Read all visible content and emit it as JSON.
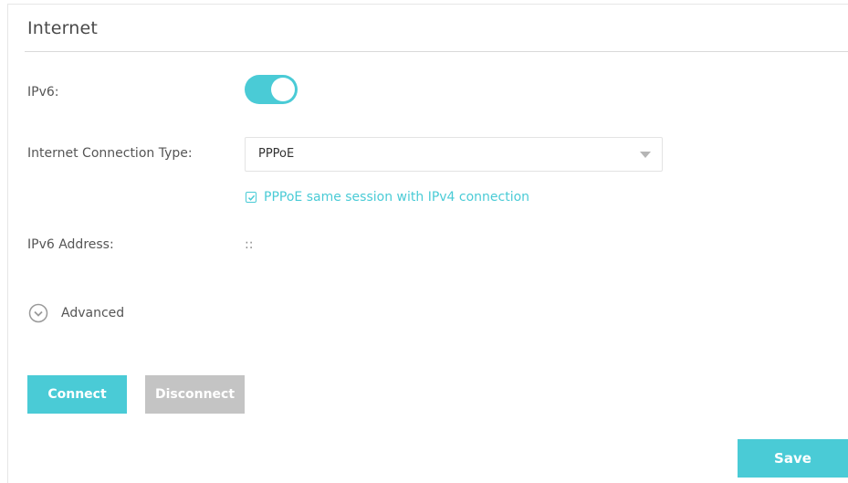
{
  "section": {
    "title": "Internet"
  },
  "form": {
    "ipv6_label": "IPv6:",
    "ipv6_enabled": true,
    "connection_type_label": "Internet Connection Type:",
    "connection_type_value": "PPPoE",
    "same_session_label": "PPPoE same session with IPv4 connection",
    "same_session_checked": true,
    "ipv6_address_label": "IPv6 Address:",
    "ipv6_address_value": "::"
  },
  "advanced": {
    "label": "Advanced",
    "icon": "chevron-down-circle-icon"
  },
  "buttons": {
    "connect_label": "Connect",
    "disconnect_label": "Disconnect",
    "save_label": "Save"
  },
  "colors": {
    "accent": "#4acbd6",
    "disabled": "#c4c4c4",
    "text": "#555555"
  }
}
